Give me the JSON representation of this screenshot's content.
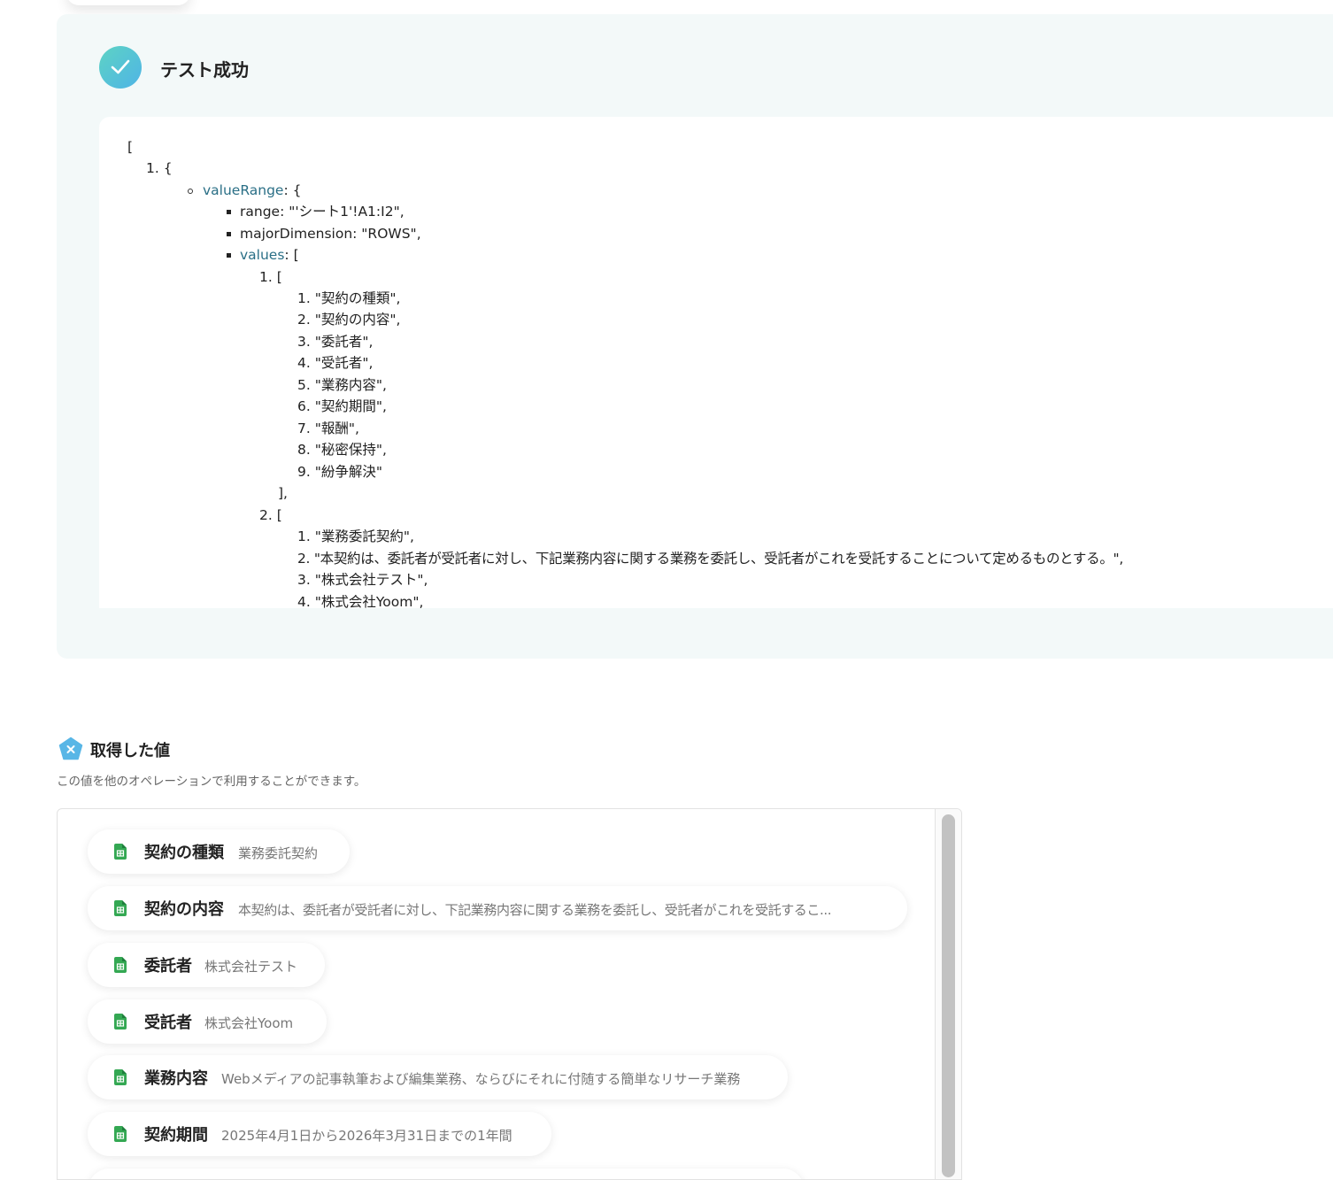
{
  "test_result": {
    "title": "テスト成功",
    "json_lines": {
      "open_bracket": "[",
      "item1": "1. {",
      "value_range_key": "valueRange",
      "value_range_rest": ": {",
      "range": "range: \"'シート1'!A1:I2\",",
      "major_dimension": "majorDimension: \"ROWS\",",
      "values_key": "values",
      "values_rest": ": [",
      "row1_open": "1. [",
      "row1": [
        "1. \"契約の種類\",",
        "2. \"契約の内容\",",
        "3. \"委託者\",",
        "4. \"受託者\",",
        "5. \"業務内容\",",
        "6. \"契約期間\",",
        "7. \"報酬\",",
        "8. \"秘密保持\",",
        "9. \"紛争解決\""
      ],
      "row1_close": "],",
      "row2_open": "2. [",
      "row2": [
        "1. \"業務委託契約\",",
        "2. \"本契約は、委託者が受託者に対し、下記業務内容に関する業務を委託し、受託者がこれを受託することについて定めるものとする。\",",
        "3. \"株式会社テスト\",",
        "4. \"株式会社Yoom\","
      ]
    }
  },
  "obtained_values": {
    "title": "取得した値",
    "description": "この値を他のオペレーションで利用することができます。",
    "items": [
      {
        "key": "契約の種類",
        "value": "業務委託契約"
      },
      {
        "key": "契約の内容",
        "value": "本契約は、委託者が受託者に対し、下記業務内容に関する業務を委託し、受託者がこれを受託するこ..."
      },
      {
        "key": "委託者",
        "value": "株式会社テスト"
      },
      {
        "key": "受託者",
        "value": "株式会社Yoom"
      },
      {
        "key": "業務内容",
        "value": "Webメディアの記事執筆および編集業務、ならびにそれに付随する簡単なリサーチ業務"
      },
      {
        "key": "契約期間",
        "value": "2025年4月1日から2026年3月31日までの1年間"
      }
    ]
  },
  "colors": {
    "accent_teal": "#5dd3c4",
    "accent_blue": "#4fb4e6",
    "sheet_green": "#34a853",
    "json_key": "#2a6f86"
  },
  "icons": {
    "status": "check-icon",
    "values_header": "variable-pentagon-icon",
    "chip": "google-sheets-icon"
  }
}
